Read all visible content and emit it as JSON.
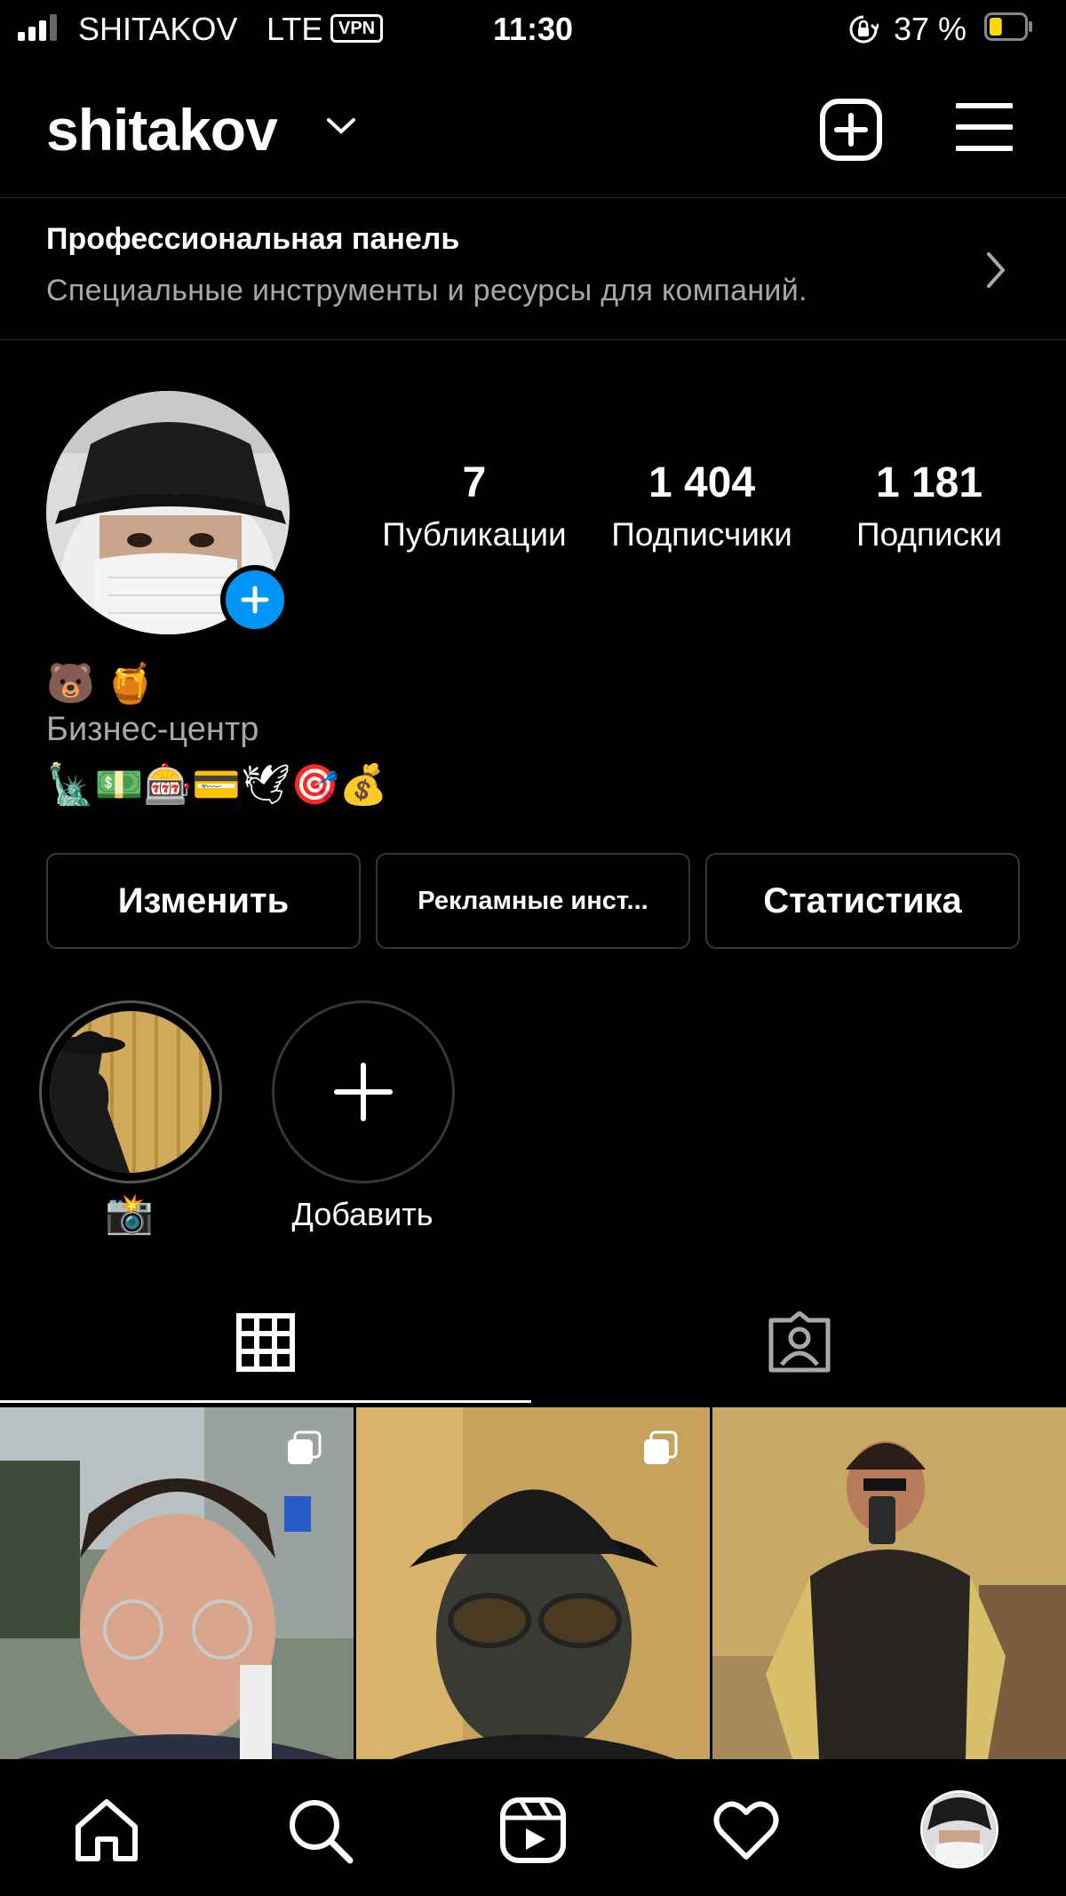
{
  "status_bar": {
    "carrier": "SHITAKOV",
    "network": "LTE",
    "vpn": "VPN",
    "time": "11:30",
    "battery_percent": "37 %",
    "battery_level": 0.37
  },
  "header": {
    "username": "shitakov",
    "icons": [
      "chevron-down-icon",
      "new-post-icon",
      "menu-icon"
    ]
  },
  "pro_dashboard": {
    "title": "Профессиональная панель",
    "subtitle": "Специальные инструменты и ресурсы для компаний."
  },
  "profile": {
    "stats": [
      {
        "count": "7",
        "label": "Публикации"
      },
      {
        "count": "1 404",
        "label": "Подписчики"
      },
      {
        "count": "1 181",
        "label": "Подписки"
      }
    ],
    "bio_emoji_line1": "🐻 🍯",
    "category": "Бизнес-центр",
    "bio_emoji_line2": "🗽💵🎰💳🕊🎯💰"
  },
  "buttons": {
    "edit": "Изменить",
    "ad_tools": "Рекламные инст...",
    "insights": "Статистика"
  },
  "highlights": [
    {
      "label": "📸"
    },
    {
      "label": "Добавить"
    }
  ],
  "tabs": [
    "grid-icon",
    "tagged-icon"
  ],
  "bottom_nav": [
    "home-icon",
    "search-icon",
    "reels-icon",
    "heart-icon",
    "profile-avatar"
  ],
  "colors": {
    "background": "#000000",
    "accent_blue": "#0095f6",
    "secondary_text": "#a8a8a8",
    "divider": "#262626",
    "battery_yellow": "#ffd60a"
  }
}
